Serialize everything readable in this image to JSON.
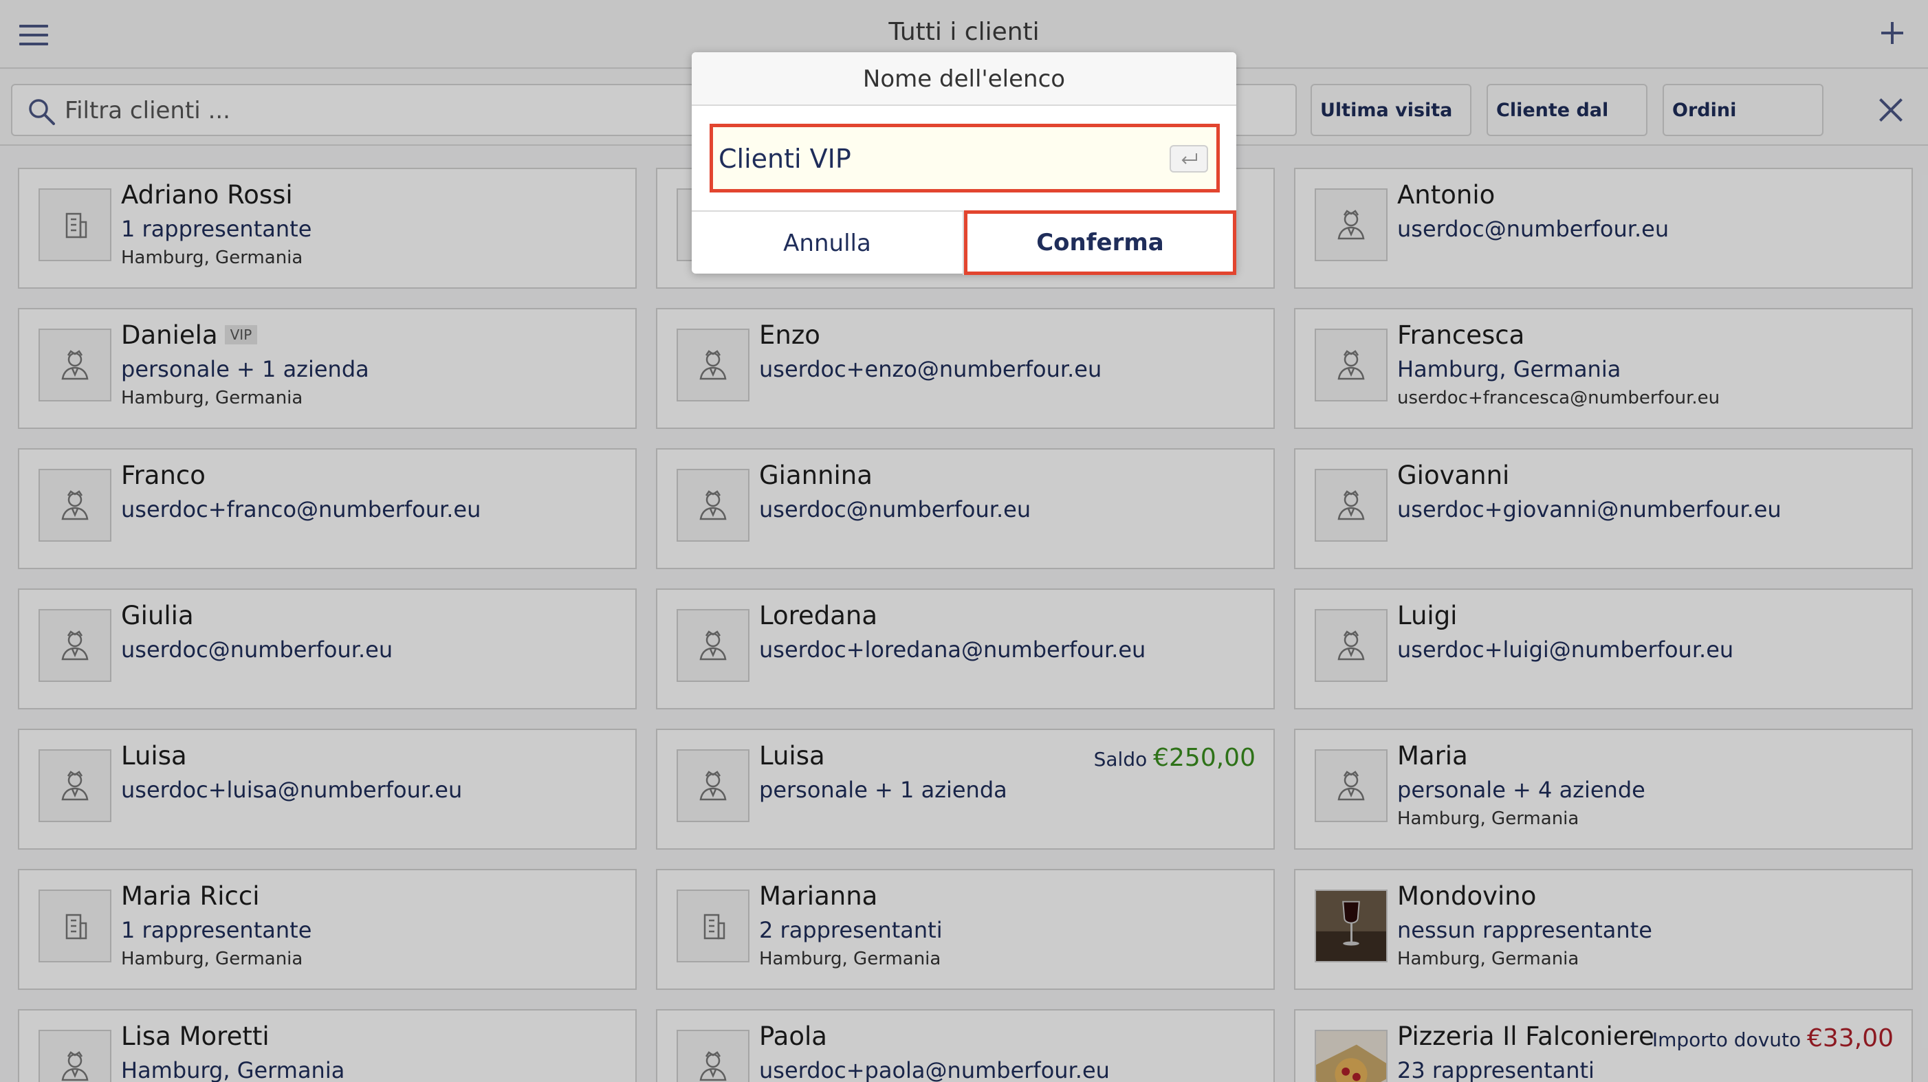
{
  "header": {
    "title": "Tutti i clienti"
  },
  "filter": {
    "placeholder": "Filtra clienti ...",
    "sort_buttons": [
      "Ultima visita",
      "Cliente dal",
      "Ordini"
    ]
  },
  "clients": [
    {
      "name": "Adriano Rossi",
      "line1": "1 rappresentante",
      "line2": "Hamburg, Germania",
      "icon": "building-icon"
    },
    {
      "name": "",
      "line1": "",
      "line2": "",
      "icon": "person-icon"
    },
    {
      "name": "Antonio",
      "line1": "userdoc@numberfour.eu",
      "line2": "",
      "icon": "person-icon"
    },
    {
      "name": "Daniela",
      "badge": "VIP",
      "line1": "personale + 1 azienda",
      "line2": "Hamburg, Germania",
      "icon": "person-icon"
    },
    {
      "name": "Enzo",
      "line1": "userdoc+enzo@numberfour.eu",
      "line2": "",
      "icon": "person-icon"
    },
    {
      "name": "Francesca",
      "line1": "Hamburg, Germania",
      "line2": "userdoc+francesca@numberfour.eu",
      "icon": "person-icon"
    },
    {
      "name": "Franco",
      "line1": "userdoc+franco@numberfour.eu",
      "line2": "",
      "icon": "person-icon"
    },
    {
      "name": "Giannina",
      "line1": "userdoc@numberfour.eu",
      "line2": "",
      "icon": "person-icon"
    },
    {
      "name": "Giovanni",
      "line1": "userdoc+giovanni@numberfour.eu",
      "line2": "",
      "icon": "person-icon"
    },
    {
      "name": "Giulia",
      "line1": "userdoc@numberfour.eu",
      "line2": "",
      "icon": "person-icon"
    },
    {
      "name": "Loredana",
      "line1": "userdoc+loredana@numberfour.eu",
      "line2": "",
      "icon": "person-icon"
    },
    {
      "name": "Luigi",
      "line1": "userdoc+luigi@numberfour.eu",
      "line2": "",
      "icon": "person-icon"
    },
    {
      "name": "Luisa",
      "line1": "userdoc+luisa@numberfour.eu",
      "line2": "",
      "icon": "person-icon"
    },
    {
      "name": "Luisa",
      "line1": "personale + 1 azienda",
      "line2": "",
      "icon": "person-icon",
      "balance_label": "Saldo",
      "balance_amount": "€250,00",
      "balance_color": "#3a8f1e"
    },
    {
      "name": "Maria",
      "line1": "personale + 4 aziende",
      "line2": "Hamburg, Germania",
      "icon": "person-icon"
    },
    {
      "name": "Maria Ricci",
      "line1": "1 rappresentante",
      "line2": "Hamburg, Germania",
      "icon": "building-icon"
    },
    {
      "name": "Marianna",
      "line1": "2 rappresentanti",
      "line2": "Hamburg, Germania",
      "icon": "building-icon"
    },
    {
      "name": "Mondovino",
      "line1": "nessun rappresentante",
      "line2": "Hamburg, Germania",
      "icon": "wine-photo"
    },
    {
      "name": "Lisa Moretti",
      "line1": "Hamburg, Germania",
      "line2": "",
      "icon": "person-icon"
    },
    {
      "name": "Paola",
      "line1": "userdoc+paola@numberfour.eu",
      "line2": "",
      "icon": "person-icon"
    },
    {
      "name": "Pizzeria Il Falconiere",
      "line1": "23 rappresentanti",
      "line2": "",
      "icon": "pizza-photo",
      "balance_label": "Importo dovuto",
      "balance_amount": "€33,00",
      "balance_color": "#b0202a"
    }
  ],
  "dialog": {
    "title": "Nome dell'elenco",
    "input_value": "Clienti VIP",
    "cancel_label": "Annulla",
    "confirm_label": "Conferma"
  },
  "colors": {
    "accent": "#1f2d5a",
    "highlight": "#e2452f",
    "positive": "#3a8f1e",
    "negative": "#b0202a"
  }
}
